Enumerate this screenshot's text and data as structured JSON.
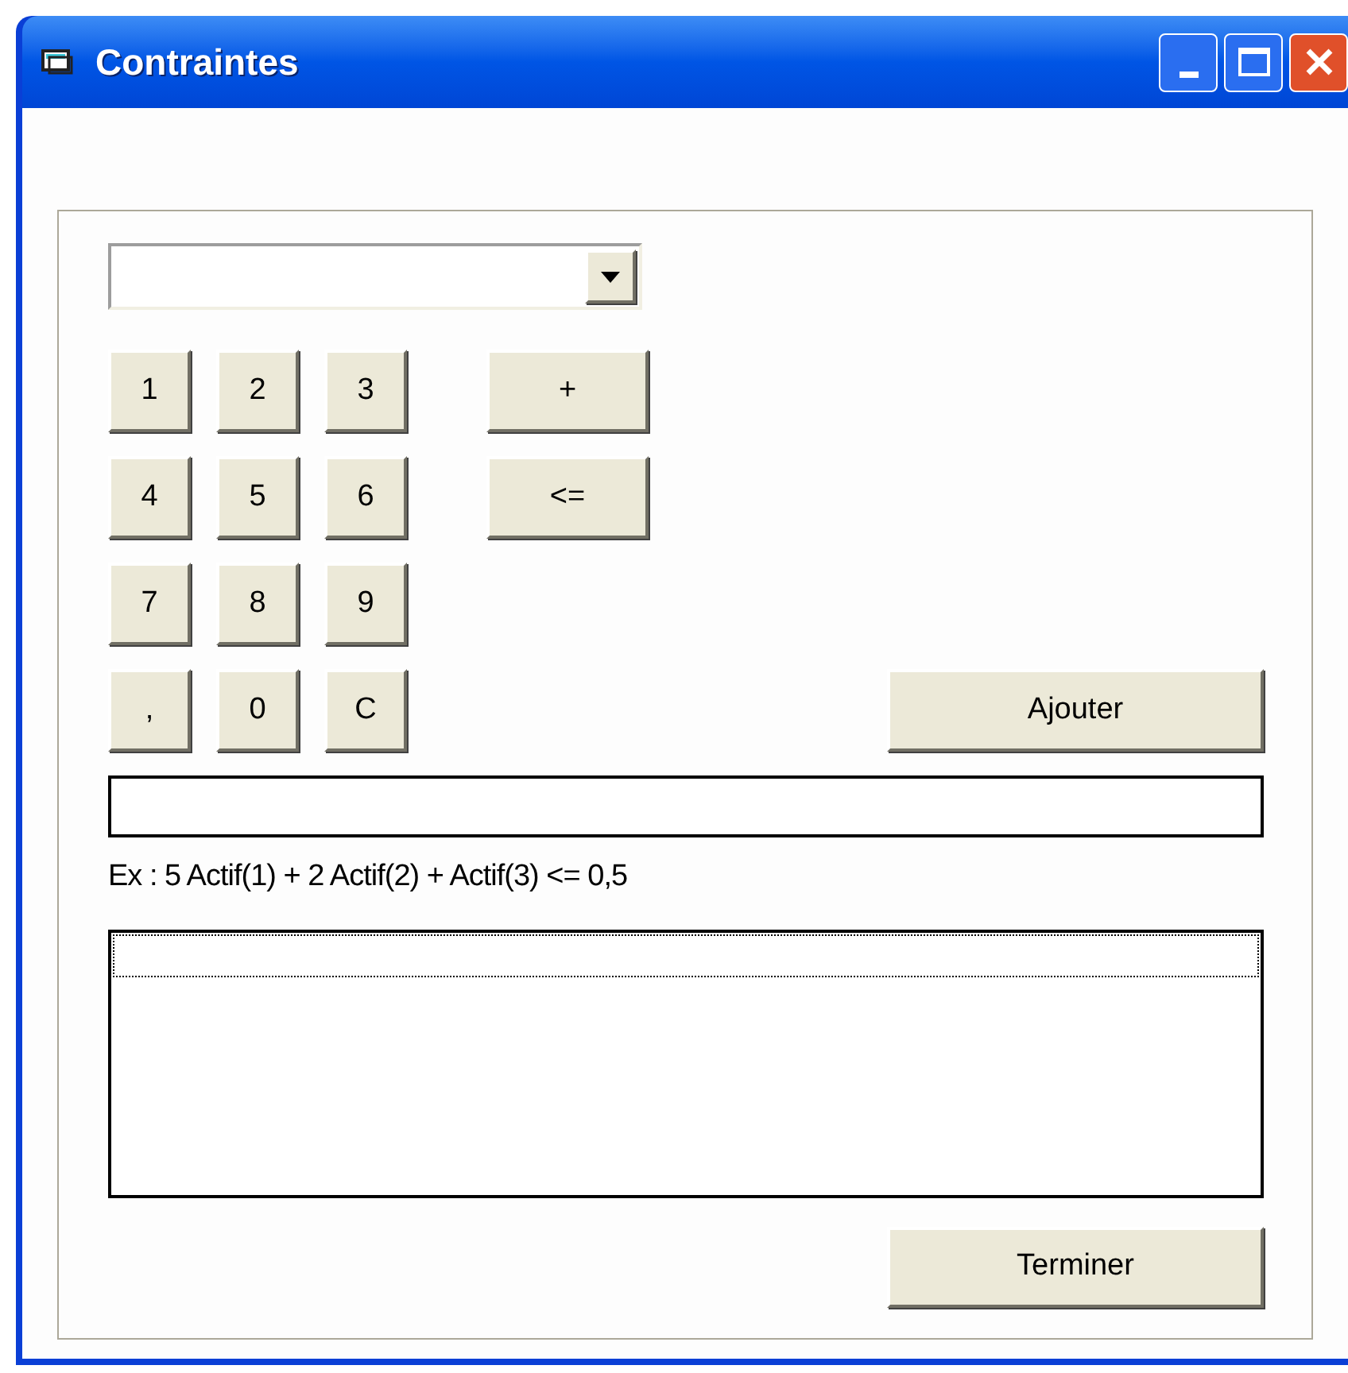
{
  "window": {
    "title": "Contraintes"
  },
  "keypad": [
    [
      "1",
      "2",
      "3"
    ],
    [
      "4",
      "5",
      "6"
    ],
    [
      "7",
      "8",
      "9"
    ],
    [
      ",",
      "0",
      "C"
    ]
  ],
  "operators": [
    "+",
    "<="
  ],
  "add_button": "Ajouter",
  "example": "Ex : 5 Actif(1) + 2 Actif(2) + Actif(3) <= 0,5",
  "constraint_list": {
    "focused": true
  },
  "finish_button": "Terminer"
}
